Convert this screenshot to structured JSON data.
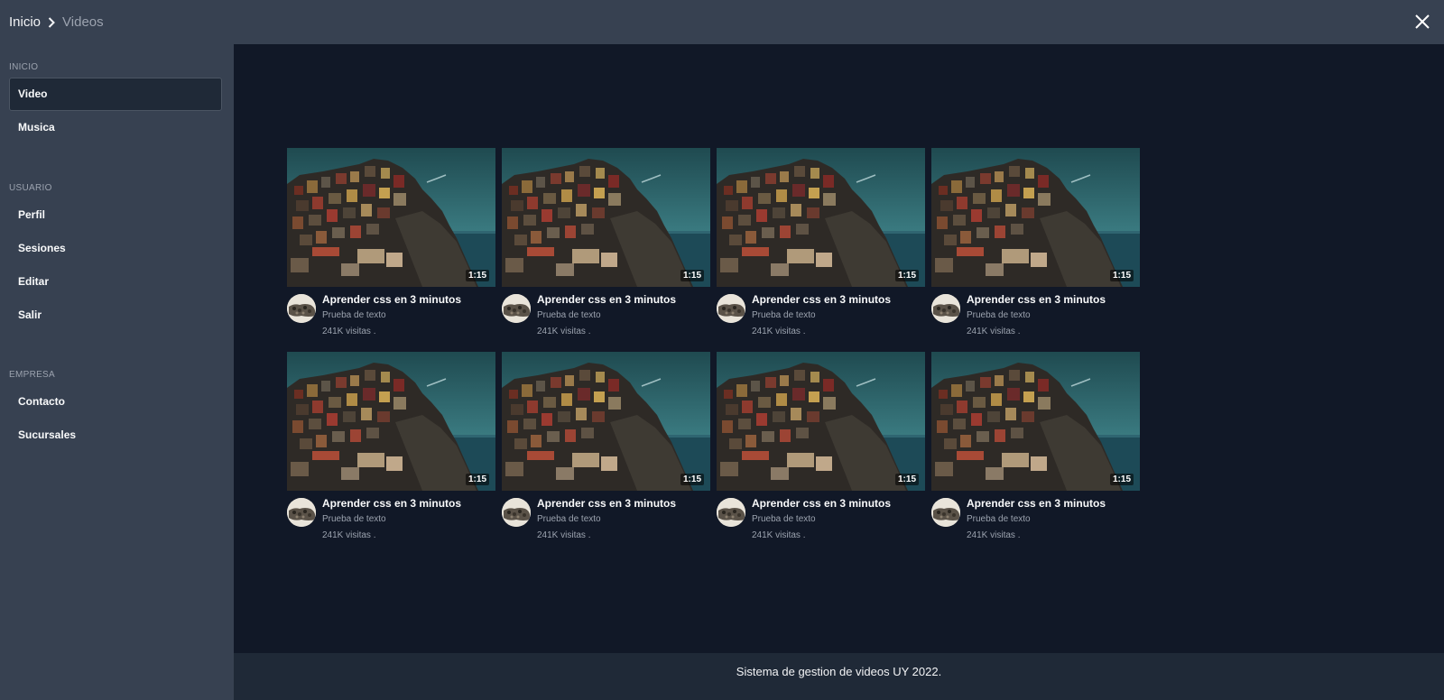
{
  "header": {
    "breadcrumb_root": "Inicio",
    "breadcrumb_current": "Videos",
    "close_icon": "close-icon"
  },
  "sidebar": {
    "sections": [
      {
        "title": "INICIO",
        "items": [
          {
            "label": "Video",
            "active": true
          },
          {
            "label": "Musica"
          }
        ]
      },
      {
        "title": "USUARIO",
        "items": [
          {
            "label": "Perfil"
          },
          {
            "label": "Sesiones"
          },
          {
            "label": "Editar"
          },
          {
            "label": "Salir"
          }
        ]
      },
      {
        "title": "EMPRESA",
        "items": [
          {
            "label": "Contacto"
          },
          {
            "label": "Sucursales"
          }
        ]
      }
    ]
  },
  "videos": [
    {
      "title": "Aprender css en 3 minutos",
      "subtitle": "Prueba de texto",
      "views": "241K visitas .",
      "duration": "1:15"
    },
    {
      "title": "Aprender css en 3 minutos",
      "subtitle": "Prueba de texto",
      "views": "241K visitas .",
      "duration": "1:15"
    },
    {
      "title": "Aprender css en 3 minutos",
      "subtitle": "Prueba de texto",
      "views": "241K visitas .",
      "duration": "1:15"
    },
    {
      "title": "Aprender css en 3 minutos",
      "subtitle": "Prueba de texto",
      "views": "241K visitas .",
      "duration": "1:15"
    },
    {
      "title": "Aprender css en 3 minutos",
      "subtitle": "Prueba de texto",
      "views": "241K visitas .",
      "duration": "1:15"
    },
    {
      "title": "Aprender css en 3 minutos",
      "subtitle": "Prueba de texto",
      "views": "241K visitas .",
      "duration": "1:15"
    },
    {
      "title": "Aprender css en 3 minutos",
      "subtitle": "Prueba de texto",
      "views": "241K visitas .",
      "duration": "1:15"
    },
    {
      "title": "Aprender css en 3 minutos",
      "subtitle": "Prueba de texto",
      "views": "241K visitas .",
      "duration": "1:15"
    }
  ],
  "footer": {
    "text": "Sistema de gestion de videos UY 2022."
  },
  "colors": {
    "header_bg": "#374151",
    "sidebar_bg": "#374151",
    "main_bg": "#111827",
    "footer_bg": "#1f2937"
  }
}
